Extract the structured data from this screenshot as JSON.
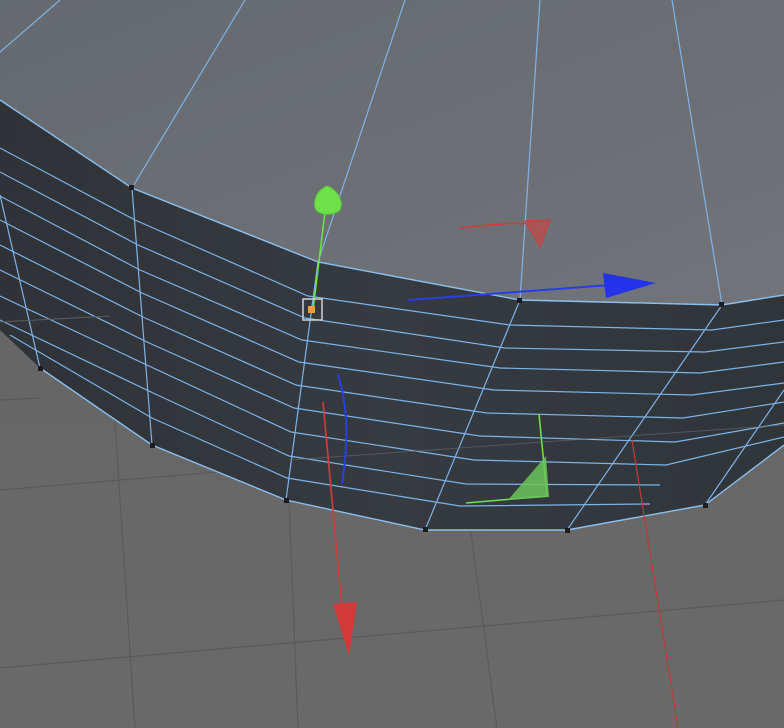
{
  "scene": {
    "object": "cylinder-mesh",
    "mode": "edge-selection",
    "gizmo": {
      "type": "move-tool",
      "axes": [
        "x",
        "y",
        "z"
      ]
    }
  },
  "colors": {
    "background": "#6b6b6b",
    "grid": "#5a5a5a",
    "cap": "#6d7075",
    "side": "#353a40",
    "wireframe": "#7fb2e6",
    "axis_x": "#d63a3a",
    "axis_y": "#6ee04a",
    "axis_z": "#2a3ee6",
    "pivot": "#f0a030"
  },
  "icons": {
    "y_handle": "green-sphere-icon",
    "z_handle": "blue-cone-icon",
    "x_handle": "red-cone-icon",
    "pivot": "pivot-square-icon"
  }
}
